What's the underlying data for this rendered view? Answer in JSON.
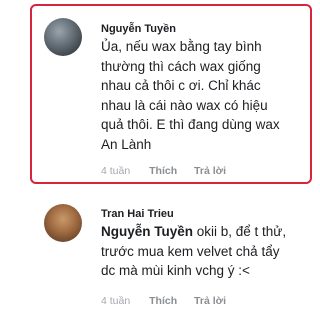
{
  "comments": [
    {
      "author": "Nguyễn Tuyền",
      "text_lines": [
        "Ủa, nếu wax bằng tay bình",
        "thường thì cách wax giống",
        "nhau cả thôi c ơi. Chỉ khác",
        "nhau là cái nào wax có hiệu",
        "quả thôi. E thì đang dùng wax",
        "An Lành"
      ],
      "time": "4 tuần",
      "like_label": "Thích",
      "reply_label": "Trả lời",
      "highlighted": true,
      "highlight_color": "#d6243c"
    },
    {
      "author": "Tran Hai Trieu",
      "mention": "Nguyễn Tuyền",
      "text_first_line_rest": " okii b, để t thử,",
      "text_lines": [
        "trước mua kem velvet chả tẩy",
        "dc mà mùi kinh vchg ý :<"
      ],
      "time": "4 tuần",
      "like_label": "Thích",
      "reply_label": "Trả lời"
    }
  ]
}
